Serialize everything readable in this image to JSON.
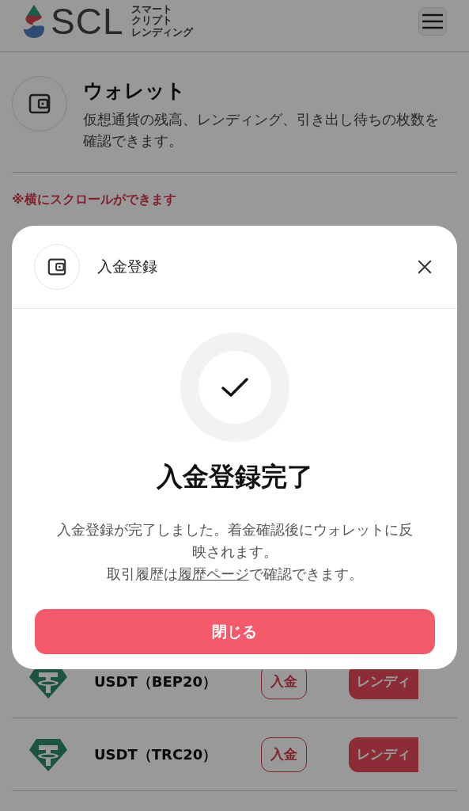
{
  "header": {
    "logo_text": "SCL",
    "logo_subtitle": [
      "スマート",
      "クリプト",
      "レンディング"
    ]
  },
  "wallet": {
    "title": "ウォレット",
    "description": "仮想通貨の残高、レンディング、引き出し待ちの枚数を確認できます。"
  },
  "scroll_note": "※横にスクロールができます",
  "assets": [
    {
      "name": "USDT（BEP20）",
      "deposit": "入金",
      "lending": "レンディ"
    },
    {
      "name": "USDT（TRC20）",
      "deposit": "入金",
      "lending": "レンディ"
    }
  ],
  "modal": {
    "title": "入金登録",
    "heading": "入金登録完了",
    "message": "入金登録が完了しました。着金確認後にウォレットに反映されます。",
    "history_prefix": "取引履歴は",
    "history_link": "履歴ページ",
    "history_suffix": "で確認できます。",
    "close_button": "閉じる"
  }
}
